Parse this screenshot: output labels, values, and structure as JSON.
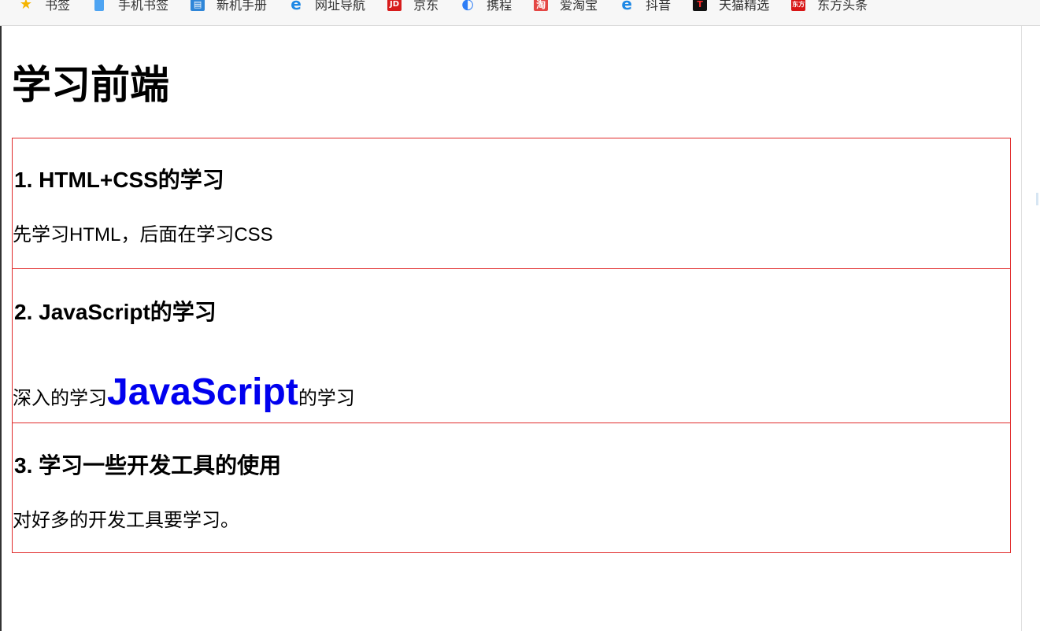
{
  "bookmarks": [
    {
      "label": "书签",
      "icon": "star-icon",
      "color": "#f5b400",
      "glyph": "★"
    },
    {
      "label": "手机书签",
      "icon": "phone-icon",
      "color": "#4ea4f2",
      "glyph": "▯"
    },
    {
      "label": "新机手册",
      "icon": "manual-icon",
      "color": "#2f86d8",
      "glyph": "▤"
    },
    {
      "label": "网址导航",
      "icon": "ie-icon",
      "color": "#1e88e5",
      "glyph": "e"
    },
    {
      "label": "京东",
      "icon": "jd-icon",
      "color": "#d71c1c",
      "glyph": "JD"
    },
    {
      "label": "携程",
      "icon": "ctrip-icon",
      "color": "#2d7df6",
      "glyph": "◐"
    },
    {
      "label": "爱淘宝",
      "icon": "taobao-icon",
      "color": "#e44745",
      "glyph": "淘"
    },
    {
      "label": "抖音",
      "icon": "ie-icon",
      "color": "#1e88e5",
      "glyph": "e"
    },
    {
      "label": "天猫精选",
      "icon": "tmall-icon",
      "color": "#111111",
      "glyph": "T"
    },
    {
      "label": "东方头条",
      "icon": "dongfang-icon",
      "color": "#d81616",
      "glyph": "东方"
    }
  ],
  "page": {
    "title": "学习前端",
    "sections": [
      {
        "heading": "1. HTML+CSS的学习",
        "text": "先学习HTML，后面在学习CSS"
      },
      {
        "heading": "2. JavaScript的学习",
        "text_before": "深入的学习",
        "highlight": "JavaScript",
        "text_after": "的学习"
      },
      {
        "heading": "3. 学习一些开发工具的使用",
        "text": "对好多的开发工具要学习。"
      }
    ]
  },
  "colors": {
    "section_border": "#e12b2b",
    "highlight_text": "#0000ee"
  }
}
